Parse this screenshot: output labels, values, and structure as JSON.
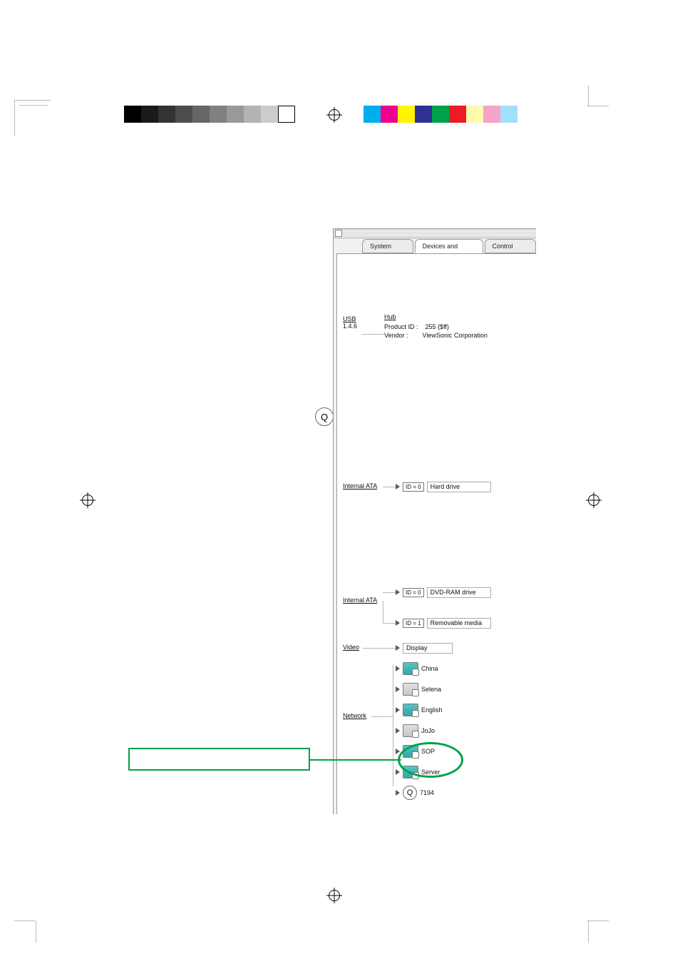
{
  "tabs": {
    "system_profile": "System Profile",
    "devices_volumes": "Devices and Volumes",
    "control_panels": "Control Panels"
  },
  "usb": {
    "bus": "USB",
    "version": "1.4.6",
    "hub_title": "Hub",
    "product_id_label": "Product ID :",
    "product_id_value": "255 ($ff)",
    "vendor_label": "Vendor :",
    "vendor_value": "ViewSonic Corporation"
  },
  "ata1": {
    "bus": "Internal ATA",
    "rows": [
      {
        "id": "ID = 0",
        "label": "Hard drive"
      }
    ]
  },
  "ata2": {
    "bus": "Internal ATA",
    "rows": [
      {
        "id": "ID = 0",
        "label": "DVD-RAM drive"
      },
      {
        "id": "ID = 1",
        "label": "Removable media"
      }
    ]
  },
  "video": {
    "bus": "Video",
    "rows": [
      {
        "label": "Display"
      }
    ]
  },
  "network": {
    "bus": "Network",
    "rows": [
      {
        "label": "China",
        "icon": "teal"
      },
      {
        "label": "Selena",
        "icon": "grey"
      },
      {
        "label": "English",
        "icon": "teal"
      },
      {
        "label": "JoJo",
        "icon": "grey"
      },
      {
        "label": "SOP",
        "icon": "teal"
      },
      {
        "label": "Server",
        "icon": "teal"
      },
      {
        "label": "7194",
        "icon": "q"
      }
    ]
  },
  "glyphs": {
    "q": "Q"
  }
}
